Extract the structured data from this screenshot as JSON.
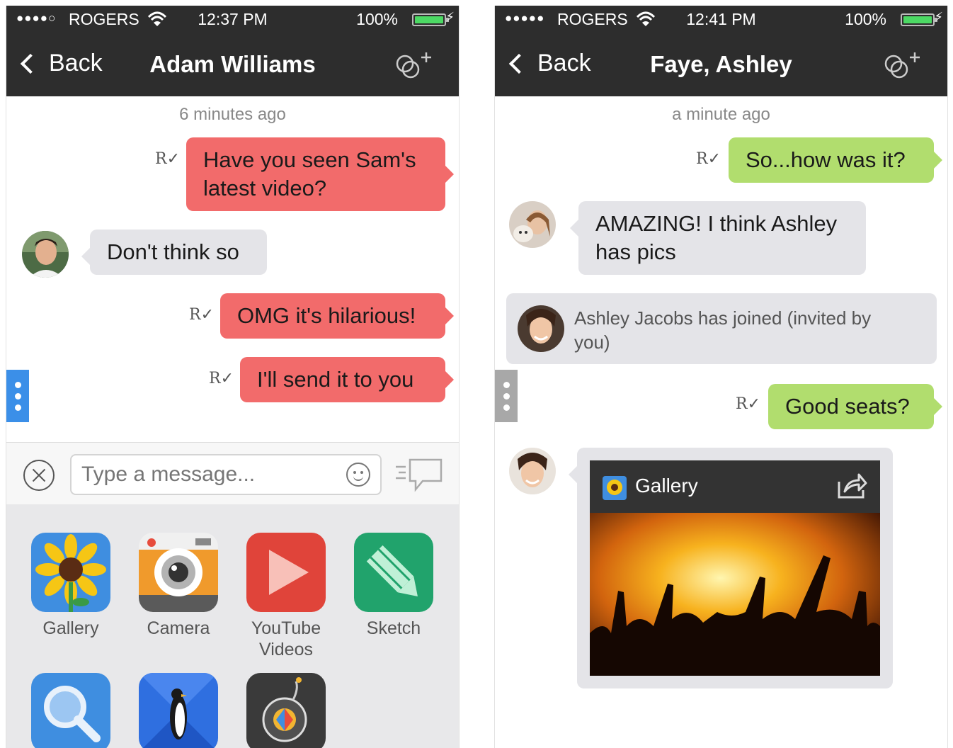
{
  "screens": [
    {
      "status": {
        "signal": "●●●●○",
        "carrier": "ROGERS",
        "time": "12:37 PM",
        "battery": "100%"
      },
      "nav": {
        "back": "Back",
        "title": "Adam Williams"
      },
      "timestamp": "6 minutes ago",
      "messages": [
        {
          "text_line1": "Have you seen Sam's",
          "text_line2": "latest video?"
        },
        {
          "text": "Don't think so"
        },
        {
          "text": "OMG it's hilarious!"
        },
        {
          "text": "I'll send it to you"
        }
      ],
      "receipt_glyph": "R",
      "composer": {
        "placeholder": "Type a message..."
      },
      "apps": [
        {
          "label": "Gallery"
        },
        {
          "label": "Camera"
        },
        {
          "label_line1": "YouTube",
          "label_line2": "Videos"
        },
        {
          "label": "Sketch"
        },
        {
          "label": ""
        },
        {
          "label": ""
        },
        {
          "label": ""
        }
      ],
      "accent": "#f26b6b",
      "handle_color": "#3b8fe8"
    },
    {
      "status": {
        "signal": "●●●●●",
        "carrier": "ROGERS",
        "time": "12:41 PM",
        "battery": "100%"
      },
      "nav": {
        "back": "Back",
        "title": "Faye, Ashley"
      },
      "timestamp": "a minute ago",
      "messages": [
        {
          "text": "So...how was it?"
        },
        {
          "text_line1": "AMAZING! I think Ashley",
          "text_line2": "has pics"
        },
        {
          "text": "Good seats?"
        }
      ],
      "system_message": "Ashley Jacobs has joined (invited by you)",
      "gallery_card": {
        "title": "Gallery"
      },
      "accent": "#b1dd6e",
      "handle_color": "#a8a8a8"
    }
  ]
}
